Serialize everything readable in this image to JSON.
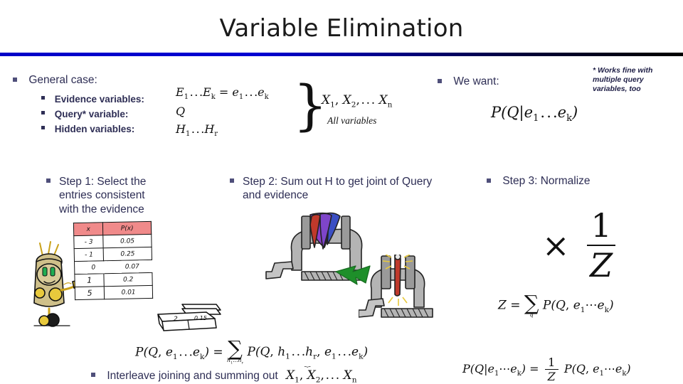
{
  "slide": {
    "title": "Variable Elimination",
    "accent_rule_color": "#0000c8",
    "text_color": "#2e2e55"
  },
  "general_case": {
    "heading": "General case:",
    "items": [
      {
        "label": "Evidence variables:",
        "math": "E1 ... Ek = e1 ... ek"
      },
      {
        "label": "Query* variable:",
        "math": "Q"
      },
      {
        "label": "Hidden variables:",
        "math": "H1 ... Hr"
      }
    ],
    "all_variables_math": "X1, X2, ... Xn",
    "all_variables_caption": "All variables"
  },
  "we_want": {
    "heading": "We want:",
    "math": "P(Q|e1 ... ek)",
    "footnote": "* Works fine with multiple query variables, too"
  },
  "steps": [
    {
      "label": "Step 1: Select the entries consistent with the evidence"
    },
    {
      "label": "Step 2: Sum out H to get joint of Query and evidence"
    },
    {
      "label": "Step 3: Normalize"
    }
  ],
  "step1_table": {
    "headers": [
      "x",
      "P(x)"
    ],
    "header_bg": "#f08a8a",
    "rows": [
      [
        "- 3",
        "0.05"
      ],
      [
        "- 1",
        "0.25"
      ],
      [
        "0",
        "0.07"
      ],
      [
        "1",
        "0.2"
      ],
      [
        "5",
        "0.01"
      ]
    ]
  },
  "step1_stack": {
    "cells": [
      "2",
      "0.15"
    ]
  },
  "step3_math": {
    "multiplier": "× 1/Z",
    "multiplier_num": "1",
    "multiplier_den": "Z",
    "z_definition": "Z = sum over q of P(Q, e1 ... ek)",
    "normalize": "P(Q|e1 ... ek) = (1/Z) P(Q, e1 ... ek)"
  },
  "bottom": {
    "joint_equation": "P(Q, e1 ... ek) = sum over h1...hr of P(Q, h1 ... hr, e1 ... ek)",
    "interleave_text": "Interleave joining and summing out",
    "interleave_math": "X1, X2, ... Xn"
  },
  "icons": {
    "bullet": "square-bullet-icon",
    "robot": "robot-pointing-icon",
    "vise_top": "vise-clamp-squeezing-icon",
    "vise_bottom": "vise-clamp-compressed-icon",
    "arrow": "green-arrow-icon",
    "stack": "table-stack-icon"
  }
}
